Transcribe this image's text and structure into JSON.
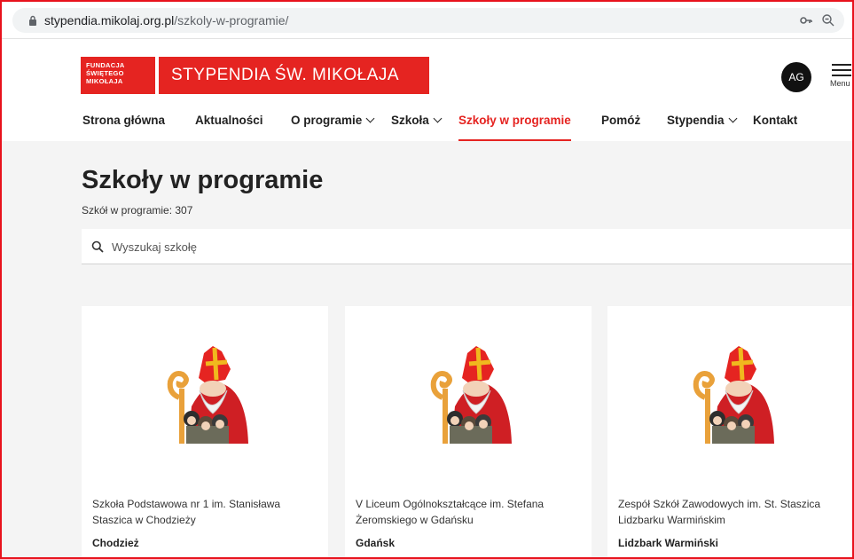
{
  "browser": {
    "url_host": "stypendia.mikolaj.org.pl",
    "url_path": "/szkoly-w-programie/"
  },
  "header": {
    "logo_small_lines": [
      "FUNDACJA",
      "ŚWIĘTEGO",
      "MIKOŁAJA"
    ],
    "logo_big": "STYPENDIA ŚW. MIKOŁAJA",
    "avatar": "AG",
    "menu_label": "Menu"
  },
  "nav": {
    "items": [
      {
        "label": "Strona główna"
      },
      {
        "label": "Aktualności"
      },
      {
        "label": "O programie"
      },
      {
        "label": "Szkoła"
      },
      {
        "label": "Szkoły w programie"
      },
      {
        "label": "Pomóż"
      },
      {
        "label": "Stypendia"
      },
      {
        "label": "Kontakt"
      }
    ]
  },
  "main": {
    "title": "Szkoły w programie",
    "count": "Szkół w programie: 307",
    "search_placeholder": "Wyszukaj szkołę"
  },
  "cards": [
    {
      "name": "Szkoła Podstawowa nr 1 im. Stanisława Staszica w Chodzieży",
      "city": "Chodzież"
    },
    {
      "name": "V Liceum Ogólnokształcące im. Stefana Żeromskiego w Gdańsku",
      "city": "Gdańsk"
    },
    {
      "name": "Zespół Szkół Zawodowych im. St. Staszica Lidzbarku Warmińskim",
      "city": "Lidzbark Warmiński"
    }
  ],
  "colors": {
    "brand": "#e52421",
    "background": "#f4f4f4"
  }
}
